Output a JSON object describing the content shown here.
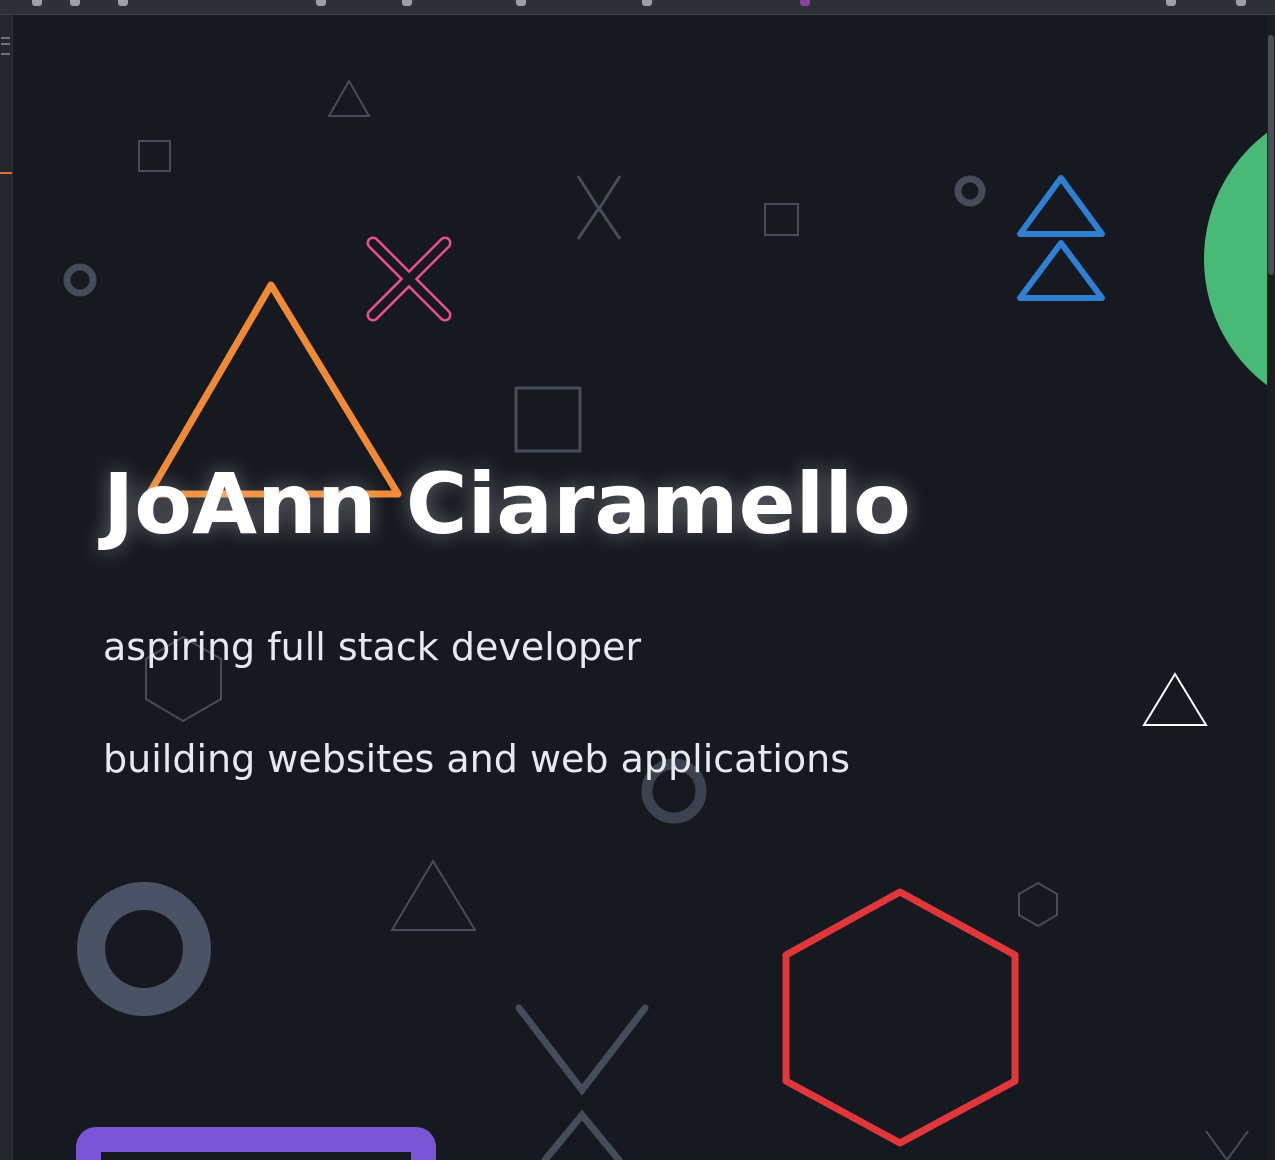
{
  "hero": {
    "name": "JoAnn Ciaramello",
    "tagline_1": "aspiring full stack developer",
    "tagline_2": "building websites and web applications"
  },
  "colors": {
    "background": "#161920",
    "orange": "#f08a34",
    "pink": "#e9508f",
    "blue": "#2f7fd3",
    "green": "#48b977",
    "red": "#e1373a",
    "purple": "#7a55d6",
    "muted": "#454c5a",
    "white": "#ffffff"
  },
  "icons": [
    "triangle-outline-icon",
    "square-outline-icon",
    "x-cross-icon",
    "ring-icon",
    "hexagon-icon",
    "chevron-icon"
  ]
}
